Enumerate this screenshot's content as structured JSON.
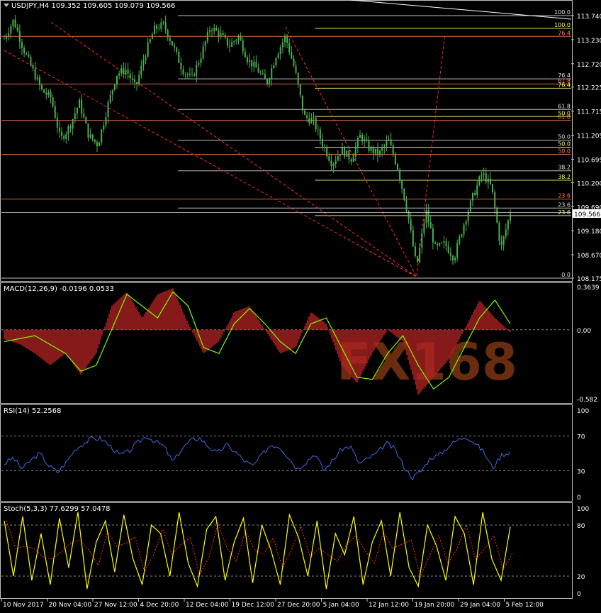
{
  "colors": {
    "background": "#000000",
    "grid": "#c0c0c0",
    "candle": "#4caf50",
    "price_line": "#ffffff",
    "fibo_red": "#ff7f50",
    "fibo_yellow": "#ffff66",
    "fibo_white": "#e0e0e0",
    "trend_red": "#ff2a2a",
    "macd_hist": "#b22222",
    "macd_signal": "#7cfc00",
    "rsi_line": "#4169e1",
    "stoch_main": "#ffff00",
    "stoch_signal": "#ff2a2a",
    "watermark": "#c0511c"
  },
  "chart": {
    "symbol_title": "USDJPY,H4  109.352 109.605 109.079 109.566",
    "current_price_label": "109.566",
    "watermark": "FX168"
  },
  "chart_data": [
    {
      "type": "candlestick",
      "title": "USDJPY,H4  109.352 109.605 109.079 109.566",
      "ylim": [
        108.175,
        113.74
      ],
      "y_ticks": [
        "113.740",
        "113.230",
        "112.720",
        "112.225",
        "111.715",
        "111.205",
        "110.695",
        "110.200",
        "109.690",
        "109.180",
        "108.670",
        "108.175"
      ],
      "x_ticks": [
        "10 Nov 2017",
        "20 Nov 04:00",
        "27 Nov 12:00",
        "4 Dec 20:00",
        "12 Dec 04:00",
        "19 Dec 12:00",
        "27 Dec 20:00",
        "5 Jan 04:00",
        "12 Jan 12:00",
        "19 Jan 20:00",
        "29 Jan 04:00",
        "5 Feb 12:00"
      ],
      "last": 109.566,
      "path": [
        [
          0,
          113.25
        ],
        [
          1,
          113.65
        ],
        [
          2,
          113.05
        ],
        [
          3,
          112.6
        ],
        [
          4,
          112.15
        ],
        [
          5,
          112.0
        ],
        [
          6,
          111.1
        ],
        [
          7,
          111.4
        ],
        [
          8,
          111.9
        ],
        [
          9,
          111.2
        ],
        [
          10,
          111.0
        ],
        [
          11,
          111.8
        ],
        [
          12,
          112.5
        ],
        [
          13,
          112.6
        ],
        [
          14,
          112.2
        ],
        [
          15,
          112.9
        ],
        [
          16,
          113.45
        ],
        [
          17,
          113.55
        ],
        [
          18,
          113.1
        ],
        [
          19,
          112.6
        ],
        [
          20,
          112.4
        ],
        [
          21,
          112.9
        ],
        [
          22,
          113.5
        ],
        [
          23,
          113.35
        ],
        [
          24,
          113.1
        ],
        [
          25,
          113.3
        ],
        [
          26,
          112.8
        ],
        [
          27,
          112.6
        ],
        [
          28,
          112.3
        ],
        [
          29,
          112.9
        ],
        [
          30,
          113.3
        ],
        [
          31,
          112.6
        ],
        [
          32,
          111.6
        ],
        [
          33,
          111.5
        ],
        [
          34,
          111.0
        ],
        [
          35,
          110.6
        ],
        [
          36,
          110.9
        ],
        [
          37,
          110.7
        ],
        [
          38,
          111.2
        ],
        [
          39,
          110.9
        ],
        [
          40,
          110.8
        ],
        [
          41,
          111.1
        ],
        [
          42,
          110.5
        ],
        [
          43,
          109.6
        ],
        [
          44,
          108.4
        ],
        [
          45,
          109.6
        ],
        [
          46,
          108.8
        ],
        [
          47,
          108.9
        ],
        [
          48,
          108.6
        ],
        [
          49,
          109.3
        ],
        [
          50,
          109.9
        ],
        [
          51,
          110.4
        ],
        [
          52,
          110.1
        ],
        [
          53,
          108.8
        ],
        [
          54,
          109.566
        ]
      ],
      "levels_right": [
        {
          "label": "100.0",
          "price": 113.74,
          "color": "#e0e0e0",
          "x_from": 0.31
        },
        {
          "label": "100.0",
          "price": 113.47,
          "color": "#ffff66",
          "x_from": 0.55
        },
        {
          "label": "76.4",
          "price": 113.3,
          "color": "#ff7f50",
          "x_from": 0.0
        },
        {
          "label": "76.4",
          "price": 112.4,
          "color": "#e0e0e0",
          "x_from": 0.31
        },
        {
          "label": "61.8",
          "price": 112.29,
          "color": "#ff7f50",
          "x_from": 0.0
        },
        {
          "label": "76.4",
          "price": 112.2,
          "color": "#ffff66",
          "x_from": 0.55
        },
        {
          "label": "61.8",
          "price": 111.75,
          "color": "#e0e0e0",
          "x_from": 0.31
        },
        {
          "label": "50.0",
          "price": 111.6,
          "color": "#ffff66",
          "x_from": 0.55
        },
        {
          "label": "61.8",
          "price": 111.52,
          "color": "#ff7f50",
          "x_from": 0.0
        },
        {
          "label": "50.0",
          "price": 111.1,
          "color": "#e0e0e0",
          "x_from": 0.31
        },
        {
          "label": "50.0",
          "price": 110.95,
          "color": "#ffff66",
          "x_from": 0.55
        },
        {
          "label": "50.0",
          "price": 110.8,
          "color": "#ff7f50",
          "x_from": 0.0
        },
        {
          "label": "38.2",
          "price": 110.45,
          "color": "#e0e0e0",
          "x_from": 0.31
        },
        {
          "label": "38.2",
          "price": 110.25,
          "color": "#ffff66",
          "x_from": 0.55
        },
        {
          "label": "23.6",
          "price": 109.85,
          "color": "#ff7f50",
          "x_from": 0.0
        },
        {
          "label": "23.6",
          "price": 109.66,
          "color": "#e0e0e0",
          "x_from": 0.31
        },
        {
          "label": "23.6",
          "price": 109.5,
          "color": "#ffff66",
          "x_from": 0.55
        },
        {
          "label": "0.0",
          "price": 108.175,
          "color": "#e0e0e0",
          "x_from": 0.0
        }
      ]
    },
    {
      "type": "histogram+line",
      "title": "MACD(12,26,9) -0.0196 0.0533",
      "ylim": [
        -0.582,
        0.3639
      ],
      "y_ticks": [
        "0.3639",
        "0.00",
        "-0.582"
      ],
      "macd": [
        [
          0,
          -0.08
        ],
        [
          2,
          -0.12
        ],
        [
          4,
          -0.2
        ],
        [
          6,
          -0.3
        ],
        [
          8,
          -0.2
        ],
        [
          10,
          -0.38
        ],
        [
          12,
          -0.2
        ],
        [
          14,
          0.2
        ],
        [
          16,
          0.32
        ],
        [
          18,
          0.1
        ],
        [
          20,
          0.3
        ],
        [
          22,
          0.35
        ],
        [
          24,
          0.05
        ],
        [
          26,
          -0.2
        ],
        [
          28,
          -0.1
        ],
        [
          30,
          0.15
        ],
        [
          32,
          0.2
        ],
        [
          34,
          0.0
        ],
        [
          36,
          -0.2
        ],
        [
          38,
          -0.15
        ],
        [
          40,
          0.15
        ],
        [
          42,
          0.05
        ],
        [
          44,
          -0.3
        ],
        [
          46,
          -0.45
        ],
        [
          48,
          -0.2
        ],
        [
          50,
          0.0
        ],
        [
          52,
          -0.1
        ],
        [
          54,
          -0.55
        ],
        [
          56,
          -0.4
        ],
        [
          58,
          -0.25
        ],
        [
          60,
          0.0
        ],
        [
          62,
          0.25
        ],
        [
          64,
          0.1
        ],
        [
          66,
          -0.02
        ]
      ],
      "signal": [
        [
          0,
          -0.1
        ],
        [
          4,
          -0.05
        ],
        [
          8,
          -0.2
        ],
        [
          10,
          -0.35
        ],
        [
          12,
          -0.3
        ],
        [
          14,
          0.0
        ],
        [
          16,
          0.3
        ],
        [
          18,
          0.2
        ],
        [
          20,
          0.1
        ],
        [
          22,
          0.32
        ],
        [
          24,
          0.2
        ],
        [
          26,
          -0.15
        ],
        [
          28,
          -0.2
        ],
        [
          30,
          0.05
        ],
        [
          32,
          0.18
        ],
        [
          34,
          0.05
        ],
        [
          36,
          -0.1
        ],
        [
          38,
          -0.2
        ],
        [
          40,
          0.05
        ],
        [
          42,
          0.1
        ],
        [
          44,
          -0.15
        ],
        [
          46,
          -0.4
        ],
        [
          48,
          -0.42
        ],
        [
          50,
          -0.2
        ],
        [
          52,
          -0.05
        ],
        [
          54,
          -0.3
        ],
        [
          56,
          -0.5
        ],
        [
          58,
          -0.4
        ],
        [
          60,
          -0.15
        ],
        [
          62,
          0.1
        ],
        [
          64,
          0.25
        ],
        [
          66,
          0.05
        ]
      ]
    },
    {
      "type": "line",
      "title": "RSI(14) 52.2568",
      "ylim": [
        0,
        100
      ],
      "y_ticks": [
        "100",
        "70",
        "30",
        "0"
      ],
      "levels": [
        70,
        30
      ],
      "values": [
        38,
        45,
        32,
        42,
        50,
        36,
        28,
        40,
        55,
        62,
        68,
        66,
        58,
        48,
        52,
        62,
        70,
        64,
        58,
        40,
        55,
        65,
        68,
        58,
        50,
        60,
        52,
        42,
        35,
        48,
        60,
        58,
        46,
        32,
        40,
        50,
        30,
        42,
        55,
        58,
        38,
        44,
        50,
        62,
        55,
        35,
        22,
        30,
        45,
        48,
        58,
        65,
        70,
        62,
        52,
        33,
        48,
        52
      ]
    },
    {
      "type": "line",
      "title": "Stoch(5,3,3) 77.6299 57.0478",
      "ylim": [
        0,
        100
      ],
      "y_ticks": [
        "100",
        "80",
        "20",
        "0"
      ],
      "levels": [
        80,
        20
      ],
      "values": [
        85,
        20,
        90,
        15,
        70,
        10,
        88,
        30,
        95,
        5,
        60,
        85,
        25,
        92,
        40,
        10,
        80,
        70,
        20,
        95,
        35,
        8,
        75,
        90,
        15,
        60,
        88,
        12,
        80,
        50,
        10,
        92,
        65,
        20,
        85,
        5,
        70,
        45,
        90,
        10,
        60,
        85,
        20,
        95,
        30,
        8,
        80,
        55,
        15,
        90,
        70,
        10,
        95,
        40,
        15,
        78
      ]
    }
  ]
}
